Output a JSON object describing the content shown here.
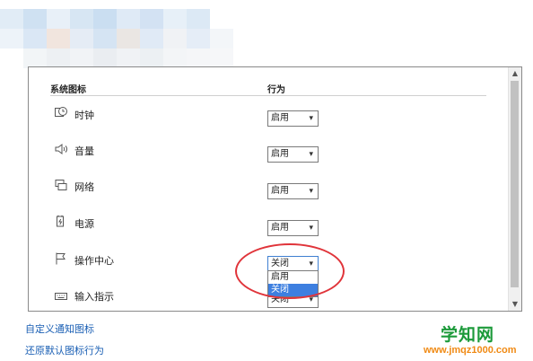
{
  "table": {
    "header_icons": "系统图标",
    "header_behavior": "行为"
  },
  "rows": [
    {
      "label": "时钟",
      "icon": "clock-icon",
      "value": "启用"
    },
    {
      "label": "音量",
      "icon": "volume-icon",
      "value": "启用"
    },
    {
      "label": "网络",
      "icon": "network-icon",
      "value": "启用"
    },
    {
      "label": "电源",
      "icon": "power-icon",
      "value": "启用"
    },
    {
      "label": "操作中心",
      "icon": "flag-icon",
      "value": "关闭"
    },
    {
      "label": "输入指示",
      "icon": "keyboard-icon",
      "value": "关闭"
    }
  ],
  "dropdown": {
    "options": [
      "启用",
      "关闭"
    ],
    "highlighted": "关闭"
  },
  "links": {
    "customize": "自定义通知图标",
    "restore": "还原默认图标行为"
  },
  "watermark": {
    "name": "学知网",
    "url": "www.jmqz1000.com"
  },
  "colors": {
    "link": "#1a5fb4",
    "selection": "#3d7fe0",
    "annotation": "#e0343a",
    "watermark_name": "#1c9a3a",
    "watermark_url": "#f08a14"
  }
}
